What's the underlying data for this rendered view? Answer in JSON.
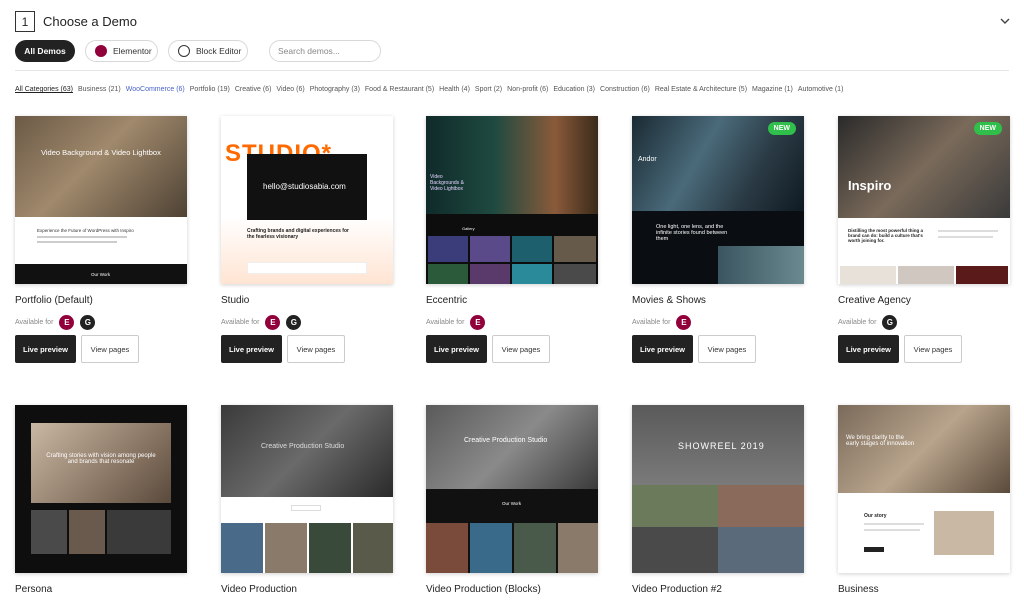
{
  "header": {
    "step": "1",
    "title": "Choose a Demo"
  },
  "filters": {
    "all_label": "All Demos",
    "elementor_label": "Elementor",
    "block_editor_label": "Block Editor",
    "search_placeholder": "Search demos..."
  },
  "categories": [
    "All Categories (63)",
    "Business (21)",
    "WooCommerce (6)",
    "Portfolio (19)",
    "Creative (6)",
    "Video (6)",
    "Photography (3)",
    "Food & Restaurant (5)",
    "Health (4)",
    "Sport (2)",
    "Non-profit (6)",
    "Education (3)",
    "Construction (6)",
    "Real Estate & Architecture (5)",
    "Magazine (1)",
    "Automotive (1)"
  ],
  "card_labels": {
    "available_for": "Available for",
    "live_preview": "Live preview",
    "view_pages": "View pages",
    "new_badge": "NEW"
  },
  "demos_row1": [
    {
      "name": "Portfolio (Default)",
      "builders": [
        "elementor",
        "block-editor"
      ],
      "new": false,
      "thumb_text": "Video Background & Video Lightbox",
      "thumb_sub": "Experience the Future of WordPress with Inspiro",
      "thumb_footer": "Our Work"
    },
    {
      "name": "Studio",
      "builders": [
        "elementor",
        "block-editor"
      ],
      "new": false,
      "thumb_text": "STUDIO*",
      "thumb_sub": "hello@studiosabia.com",
      "thumb_footer": "Crafting brands and digital experiences for the fearless visionary"
    },
    {
      "name": "Eccentric",
      "builders": [
        "elementor"
      ],
      "new": false,
      "thumb_text": "Video Backgrounds & Video Lightbox",
      "thumb_sub": "Gallery",
      "thumb_footer": ""
    },
    {
      "name": "Movies & Shows",
      "builders": [
        "elementor"
      ],
      "new": true,
      "thumb_text": "Andor",
      "thumb_sub": "One light, one lens, and the infinite stories found between them",
      "thumb_footer": ""
    },
    {
      "name": "Creative Agency",
      "builders": [
        "block-editor"
      ],
      "new": true,
      "thumb_text": "Inspiro",
      "thumb_sub": "Distilling the most powerful thing a brand can do: build a culture that's worth joining for.",
      "thumb_footer": ""
    }
  ],
  "demos_row2": [
    {
      "name": "Persona",
      "thumb_text": "Crafting stories with vision among people and brands that resonate"
    },
    {
      "name": "Video Production",
      "thumb_text": "Creative Production Studio"
    },
    {
      "name": "Video Production (Blocks)",
      "thumb_text": "Creative Production Studio",
      "thumb_sub": "Our Work"
    },
    {
      "name": "Video Production #2",
      "thumb_text": "SHOWREEL 2019"
    },
    {
      "name": "Business",
      "thumb_text": "We bring clarity to the early stages of innovation",
      "thumb_sub": "Our story"
    }
  ],
  "colors": {
    "elementor": "#92003b",
    "dark": "#222222",
    "new_badge": "#2fbf4a",
    "studio_orange": "#ff6a00",
    "link_accent": "#4a63c6"
  }
}
